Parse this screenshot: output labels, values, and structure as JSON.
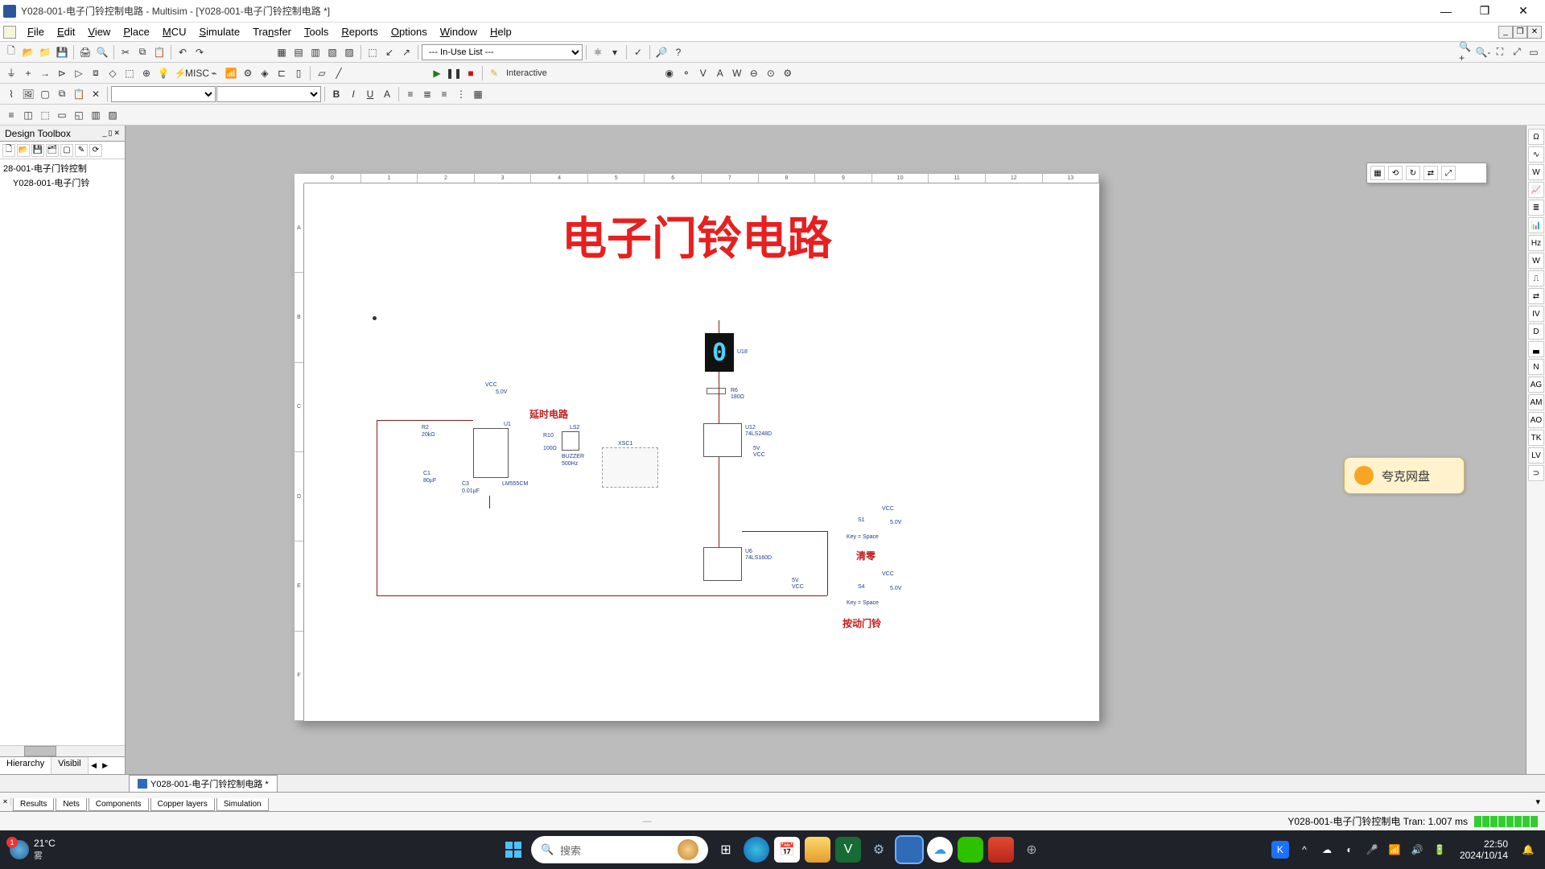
{
  "window": {
    "title": "Y028-001-电子门铃控制电路 - Multisim - [Y028-001-电子门铃控制电路 *]",
    "min": "—",
    "max": "❐",
    "close": "✕"
  },
  "menu": {
    "file": "File",
    "edit": "Edit",
    "view": "View",
    "place": "Place",
    "mcu": "MCU",
    "simulate": "Simulate",
    "transfer": "Transfer",
    "tools": "Tools",
    "reports": "Reports",
    "options": "Options",
    "window": "Window",
    "help": "Help"
  },
  "toolbar1": {
    "inuse_combo": "--- In-Use List ---"
  },
  "sim_toolbar": {
    "play": "▶",
    "pause": "❚❚",
    "stop": "■",
    "wand": "✎",
    "interactive": "Interactive"
  },
  "left_panel": {
    "title": "Design Toolbox",
    "tree_item1": "28-001-电子门铃控制",
    "tree_item2": "Y028-001-电子门铃",
    "tab_hierarchy": "Hierarchy",
    "tab_visibility": "Visibil"
  },
  "circuit": {
    "title": "电子门铃电路",
    "delay_circuit": "延时电路",
    "clear_label": "清零",
    "press_bell": "按动门铃",
    "vcc": "VCC",
    "vcc5v": "5.0V",
    "r2": "R2",
    "r2_val": "20kΩ",
    "r10": "R10",
    "r10_val": "100Ω",
    "c1": "C1",
    "c1_val": "80µF",
    "c3": "C3",
    "c3_val": "0.01µF",
    "u1": "U1",
    "lm555": "LM555CM",
    "ls2": "LS2",
    "buzzer": "BUZZER",
    "buzzer_hz": "500Hz",
    "xsc1": "XSC1",
    "u18": "U18",
    "u12": "U12",
    "u12_part": "74LS248D",
    "u6": "U6",
    "u6_part": "74LS160D",
    "r6": "R6",
    "r6_val": "180Ω",
    "s1": "S1",
    "s4": "S4",
    "key_space": "Key = Space",
    "seven_seg_digit": "0",
    "ruler_top": [
      "0",
      "1",
      "2",
      "3",
      "4",
      "5",
      "6",
      "7",
      "8",
      "9",
      "10",
      "11",
      "12",
      "13"
    ],
    "ruler_left": [
      "A",
      "B",
      "C",
      "D",
      "E",
      "F"
    ],
    "vcc5": "5V"
  },
  "float_toolbar": {
    "grid": "▦",
    "snap": "⟲",
    "t1": "↻",
    "t2": "⇄",
    "t3": "⤢"
  },
  "cloud_badge": {
    "text": "夸克网盘"
  },
  "doc_tab": {
    "label": "Y028-001-电子门铃控制电路 *"
  },
  "results_tabs": {
    "results": "Results",
    "nets": "Nets",
    "components": "Components",
    "copper": "Copper layers",
    "simulation": "Simulation"
  },
  "status": {
    "text": "Y028-001-电子门铃控制电 Tran: 1.007 ms"
  },
  "taskbar": {
    "temp": "21°C",
    "weather_desc": "雾",
    "weather_badge": "1",
    "search_placeholder": "搜索",
    "clock_time": "22:50",
    "clock_date": "2024/10/14"
  }
}
